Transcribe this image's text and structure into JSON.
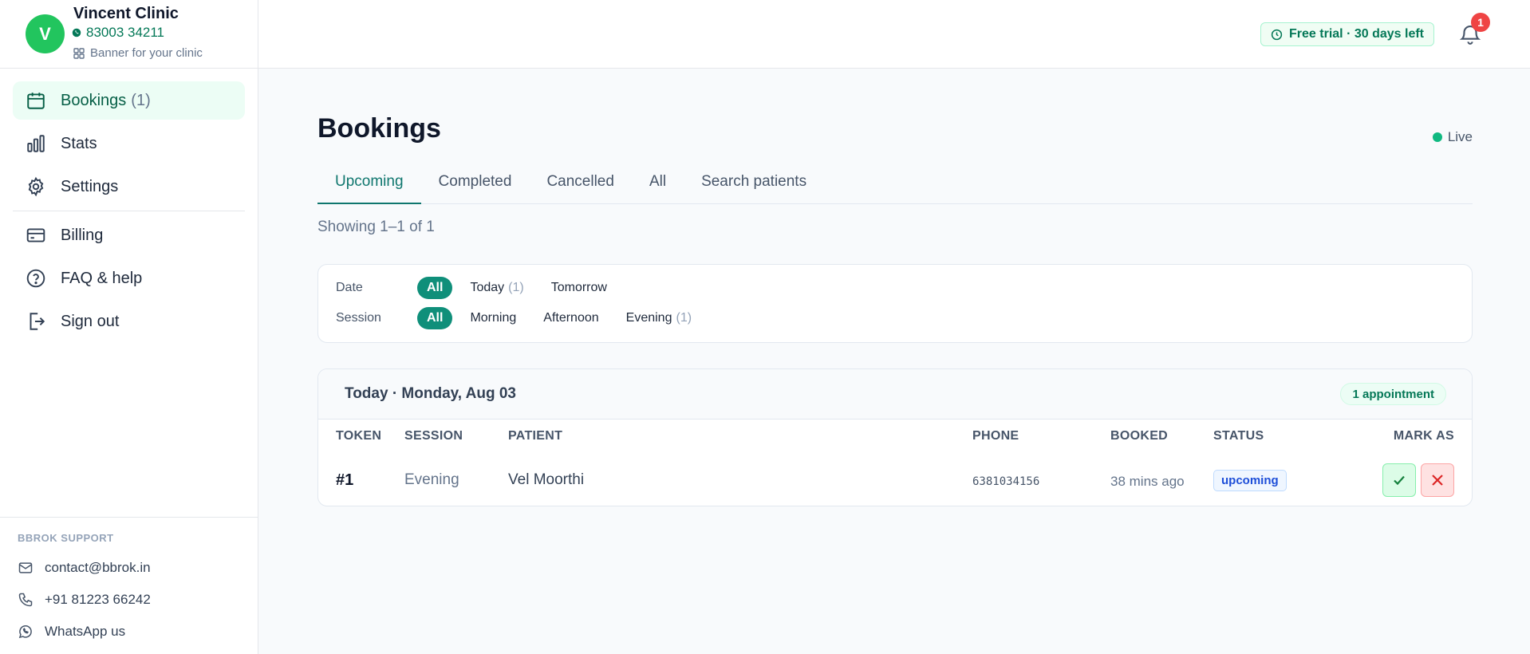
{
  "clinic": {
    "avatar_letter": "V",
    "name": "Vincent Clinic",
    "phone": "83003 34211",
    "banner_link": "Banner for your clinic"
  },
  "nav": {
    "items": [
      {
        "label": "Bookings",
        "count": "(1)",
        "icon": "calendar-icon",
        "active": true
      },
      {
        "label": "Stats",
        "icon": "bar-chart-icon"
      },
      {
        "label": "Settings",
        "icon": "gear-icon"
      },
      {
        "label": "Billing",
        "icon": "credit-card-icon"
      },
      {
        "label": "FAQ & help",
        "icon": "help-circle-icon"
      },
      {
        "label": "Sign out",
        "icon": "sign-out-icon"
      }
    ]
  },
  "support": {
    "title": "BBROK SUPPORT",
    "email": "contact@bbrok.in",
    "phone": "+91 81223 66242",
    "whatsapp": "WhatsApp us"
  },
  "topbar": {
    "trial_label": "Free trial · 30 days left",
    "notification_count": "1"
  },
  "page": {
    "title": "Bookings",
    "live_label": "Live",
    "tabs": [
      "Upcoming",
      "Completed",
      "Cancelled",
      "All",
      "Search patients"
    ],
    "active_tab": "Upcoming",
    "showing": "Showing 1–1 of 1"
  },
  "filters": {
    "date_label": "Date",
    "date_options": [
      {
        "label": "All",
        "selected": true
      },
      {
        "label": "Today",
        "count": "(1)"
      },
      {
        "label": "Tomorrow"
      }
    ],
    "session_label": "Session",
    "session_options": [
      {
        "label": "All",
        "selected": true
      },
      {
        "label": "Morning"
      },
      {
        "label": "Afternoon"
      },
      {
        "label": "Evening",
        "count": "(1)"
      }
    ]
  },
  "group": {
    "date_heading": "Today · Monday, Aug 03",
    "appointment_count": "1 appointment",
    "columns": [
      "TOKEN",
      "SESSION",
      "PATIENT",
      "PHONE",
      "BOOKED",
      "STATUS",
      "MARK AS"
    ],
    "rows": [
      {
        "token": "#1",
        "session": "Evening",
        "patient": "Vel Moorthi",
        "phone": "6381034156",
        "booked": "38 mins ago",
        "status": "upcoming"
      }
    ]
  },
  "colors": {
    "accent": "#0f8f7a",
    "active_nav_bg": "#ecfdf5",
    "status_upcoming": "#1d4ed8",
    "badge_red": "#ef4444"
  }
}
